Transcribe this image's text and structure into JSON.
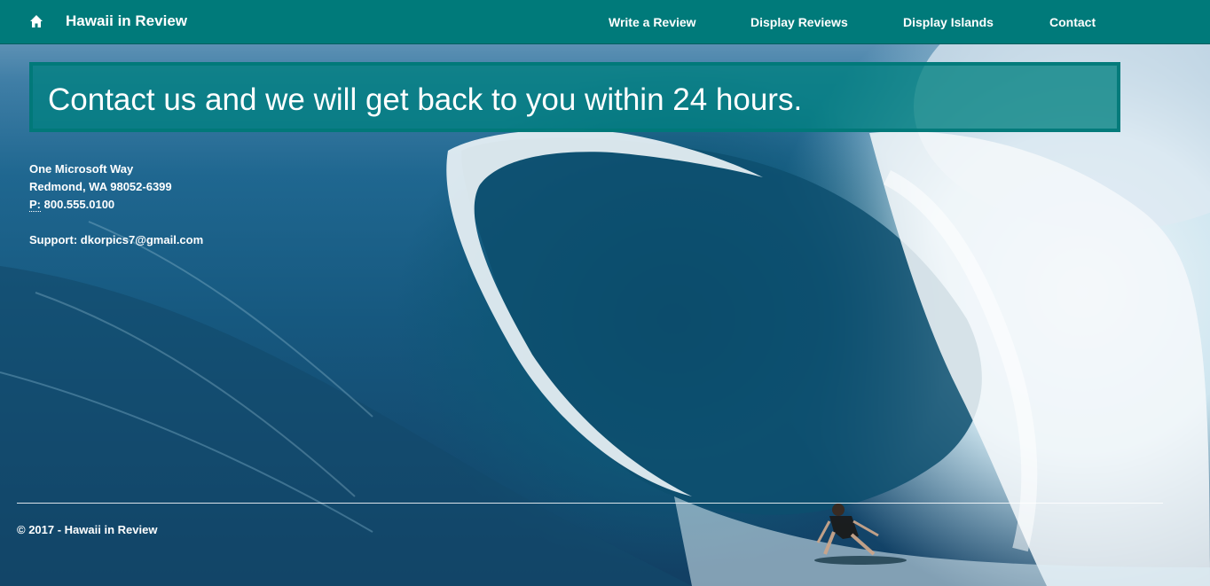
{
  "navbar": {
    "brand": "Hawaii in Review",
    "links": [
      {
        "label": "Write a Review"
      },
      {
        "label": "Display Reviews"
      },
      {
        "label": "Display Islands"
      },
      {
        "label": "Contact"
      }
    ],
    "background": "#007a7a"
  },
  "banner": {
    "heading": "Contact us and we will get back to you within 24 hours."
  },
  "address": {
    "line1": "One Microsoft Way",
    "line2": "Redmond, WA 98052-6399",
    "phone_label": "P:",
    "phone_value": "800.555.0100",
    "support_label": "Support:",
    "support_email": "dkorpics7@gmail.com"
  },
  "footer": {
    "text": "© 2017 - Hawaii in Review"
  },
  "icons": {
    "home": "home-icon"
  }
}
